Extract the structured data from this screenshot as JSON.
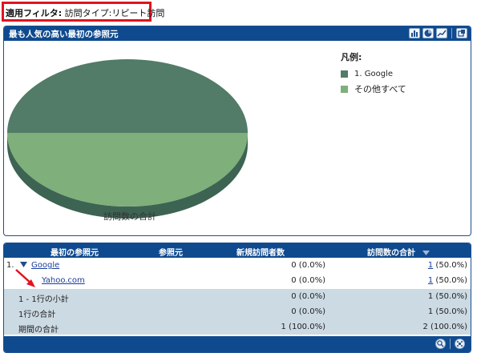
{
  "filter": {
    "label": "適用フィルタ:",
    "value": " 訪問タイプ:リピート訪問"
  },
  "chart_panel": {
    "title": "最も人気の高い最初の参照元",
    "icons": [
      "bar-chart-icon",
      "pie-chart-icon",
      "line-chart-icon",
      "export-icon"
    ]
  },
  "chart_data": {
    "type": "pie",
    "title": "最も人気の高い最初の参照元",
    "caption": "訪問数の合計",
    "legend_title": "凡例:",
    "legend_placement": "right",
    "categories": [
      "1. Google",
      "その他すべて"
    ],
    "values": [
      50.0,
      50.0
    ],
    "colors": [
      "#527b68",
      "#7faf7a"
    ]
  },
  "table": {
    "columns": [
      "最初の参照元",
      "参照元",
      "新規訪問者数",
      "訪問数の合計"
    ],
    "rows": [
      {
        "index": "1.",
        "first_source": "Google",
        "source": "",
        "new_visitors": "0 (0.0%)",
        "visits_link": "1",
        "visits_pct": " (50.0%)"
      },
      {
        "index": "",
        "first_source": "",
        "source": "Yahoo.com",
        "new_visitors": "0 (0.0%)",
        "visits_link": "1",
        "visits_pct": " (50.0%)"
      }
    ],
    "summary": [
      {
        "label": "1 - 1行の小計",
        "new_visitors": "0 (0.0%)",
        "visits": "1 (50.0%)"
      },
      {
        "label": "1行の合計",
        "new_visitors": "0 (0.0%)",
        "visits": "1 (50.0%)"
      },
      {
        "label": "期間の合計",
        "new_visitors": "1 (100.0%)",
        "visits": "2 (100.0%)"
      }
    ],
    "footer_icons": [
      "zoom-icon",
      "settings-icon"
    ]
  },
  "colors": {
    "header_blue": "#0f4a8f",
    "filter_border": "#e0141e",
    "summary_row": "#ccdae3",
    "link": "#1a3e9a",
    "arrow": "#e0141e"
  }
}
